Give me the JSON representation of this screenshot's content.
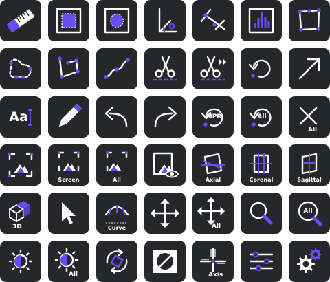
{
  "colors": {
    "tile_bg": "#26272b",
    "icon": "#ffffff",
    "accent": "#6a4cf5"
  },
  "tools": [
    {
      "icon": "ruler-icon",
      "label": ""
    },
    {
      "icon": "rectangle-roi-icon",
      "label": ""
    },
    {
      "icon": "ellipse-roi-icon",
      "label": ""
    },
    {
      "icon": "angle-icon",
      "label": ""
    },
    {
      "icon": "cobb-angle-icon",
      "label": ""
    },
    {
      "icon": "histogram-icon",
      "label": ""
    },
    {
      "icon": "polygon-roi-icon",
      "label": ""
    },
    {
      "icon": "freehand-roi-icon",
      "label": ""
    },
    {
      "icon": "open-polyline-icon",
      "label": ""
    },
    {
      "icon": "spline-icon",
      "label": ""
    },
    {
      "icon": "scissors-icon",
      "label": ""
    },
    {
      "icon": "scissors-forward-icon",
      "label": ""
    },
    {
      "icon": "reset-icon",
      "label": ""
    },
    {
      "icon": "arrow-annotate-icon",
      "label": ""
    },
    {
      "icon": "text-annotate-icon",
      "label": "Aa"
    },
    {
      "icon": "pencil-icon",
      "label": ""
    },
    {
      "icon": "undo-icon",
      "label": ""
    },
    {
      "icon": "redo-icon",
      "label": ""
    },
    {
      "icon": "reset-mpr-icon",
      "label": "MPR"
    },
    {
      "icon": "reset-all-icon",
      "label": "All"
    },
    {
      "icon": "clear-all-icon",
      "label": "All"
    },
    {
      "icon": "capture-icon",
      "label": ""
    },
    {
      "icon": "capture-screen-icon",
      "label": "Screen"
    },
    {
      "icon": "capture-all-icon",
      "label": "All"
    },
    {
      "icon": "preview-icon",
      "label": ""
    },
    {
      "icon": "axial-plane-icon",
      "label": "Axial"
    },
    {
      "icon": "coronal-plane-icon",
      "label": "Coronal"
    },
    {
      "icon": "sagittal-plane-icon",
      "label": "Sagittal"
    },
    {
      "icon": "3d-cube-icon",
      "label": "3D"
    },
    {
      "icon": "cursor-icon",
      "label": ""
    },
    {
      "icon": "curve-icon",
      "label": "Curve"
    },
    {
      "icon": "move-icon",
      "label": ""
    },
    {
      "icon": "move-all-icon",
      "label": "All"
    },
    {
      "icon": "zoom-icon",
      "label": ""
    },
    {
      "icon": "zoom-all-icon",
      "label": "All"
    },
    {
      "icon": "window-level-icon",
      "label": ""
    },
    {
      "icon": "window-level-all-icon",
      "label": "All"
    },
    {
      "icon": "rotate-icon",
      "label": ""
    },
    {
      "icon": "invert-icon",
      "label": ""
    },
    {
      "icon": "axis-crosshair-icon",
      "label": "Axis"
    },
    {
      "icon": "sliders-icon",
      "label": ""
    },
    {
      "icon": "settings-icon",
      "label": ""
    }
  ]
}
